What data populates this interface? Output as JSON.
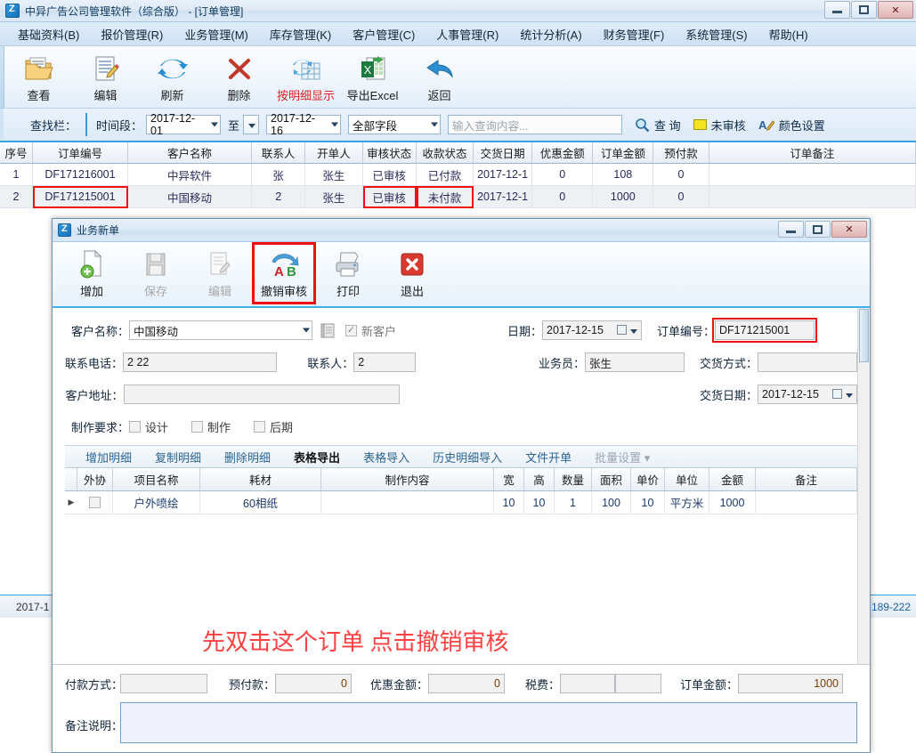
{
  "main_window": {
    "title": "中异广告公司管理软件（综合版） - [订单管理]",
    "window_buttons": {
      "minimize": "minimize-icon",
      "maximize": "maximize-icon",
      "close": "✕"
    },
    "menu": [
      {
        "label": "基础资料(B)"
      },
      {
        "label": "报价管理(R)"
      },
      {
        "label": "业务管理(M)"
      },
      {
        "label": "库存管理(K)"
      },
      {
        "label": "客户管理(C)"
      },
      {
        "label": "人事管理(R)"
      },
      {
        "label": "统计分析(A)"
      },
      {
        "label": "财务管理(F)"
      },
      {
        "label": "系统管理(S)"
      },
      {
        "label": "帮助(H)"
      }
    ],
    "toolbar": [
      {
        "label": "查看",
        "icon": "folder-view-icon",
        "highlight": false
      },
      {
        "label": "编辑",
        "icon": "edit-doc-icon",
        "highlight": false
      },
      {
        "label": "刷新",
        "icon": "refresh-icon",
        "highlight": false
      },
      {
        "label": "删除",
        "icon": "delete-x-icon",
        "highlight": false
      },
      {
        "label": "按明细显示",
        "icon": "detail-grid-icon",
        "highlight": true
      },
      {
        "label": "导出Excel",
        "icon": "export-excel-icon",
        "highlight": false
      },
      {
        "label": "返回",
        "icon": "back-arrow-icon",
        "highlight": false
      }
    ],
    "searchbar": {
      "label": "查找栏：",
      "period_label": "时间段：",
      "date_from": "2017-12-01",
      "to_label": "至",
      "date_to": "2017-12-16",
      "field_select": "全部字段",
      "query_placeholder": "输入查询内容...",
      "query_value": "",
      "search_button": "查 询",
      "unaudited_label": "未审核",
      "color_setting_label": "颜色设置"
    },
    "grid": {
      "columns": [
        "序号",
        "订单编号",
        "客户名称",
        "联系人",
        "开单人",
        "审核状态",
        "收款状态",
        "交货日期",
        "优惠金额",
        "订单金额",
        "预付款",
        "订单备注"
      ],
      "rows": [
        {
          "seq": "1",
          "order_no": "DF171216001",
          "customer": "中异软件",
          "contact": "张",
          "operator": "张生",
          "audit": "已审核",
          "payment": "已付款",
          "delivery": "2017-12-1",
          "discount": "0",
          "amount": "108",
          "prepaid": "0",
          "memo": ""
        },
        {
          "seq": "2",
          "order_no": "DF171215001",
          "customer": "中国移动",
          "contact": "2",
          "operator": "张生",
          "audit": "已审核",
          "payment": "未付款",
          "delivery": "2017-12-1",
          "discount": "0",
          "amount": "1000",
          "prepaid": "0",
          "memo": ""
        }
      ]
    },
    "statusbar": {
      "left": "2017-1",
      "right": ": 189-222"
    }
  },
  "dialog": {
    "title": "业务新单",
    "window_buttons": {
      "minimize": "minimize-icon",
      "maximize": "maximize-icon",
      "close": "✕"
    },
    "toolbar": [
      {
        "label": "增加",
        "icon": "add-doc-icon",
        "disabled": false,
        "highlight": false
      },
      {
        "label": "保存",
        "icon": "save-disk-icon",
        "disabled": true,
        "highlight": false
      },
      {
        "label": "编辑",
        "icon": "edit-doc-icon",
        "disabled": true,
        "highlight": false
      },
      {
        "label": "撤销审核",
        "icon": "undo-audit-icon",
        "disabled": false,
        "highlight": true
      },
      {
        "label": "打印",
        "icon": "printer-icon",
        "disabled": false,
        "highlight": false
      },
      {
        "label": "退出",
        "icon": "exit-x-icon",
        "disabled": false,
        "highlight": false
      }
    ],
    "form": {
      "customer_name_label": "客户名称：",
      "customer_name": "中国移动",
      "address_book_icon": "address-book-icon",
      "new_customer_label": "新客户",
      "new_customer_checked": true,
      "phone_label": "联系电话：",
      "phone": "2 22",
      "contact_label": "联系人：",
      "contact": "2",
      "address_label": "客户地址：",
      "address": "",
      "requirement_label": "制作要求：",
      "requirements": [
        {
          "label": "设计",
          "checked": false
        },
        {
          "label": "制作",
          "checked": false
        },
        {
          "label": "后期",
          "checked": false
        }
      ],
      "date_label": "日期：",
      "date": "2017-12-15",
      "order_no_label": "订单编号：",
      "order_no": "DF171215001",
      "salesman_label": "业务员：",
      "salesman": "张生",
      "delivery_method_label": "交货方式：",
      "delivery_method": "",
      "delivery_date_label": "交货日期：",
      "delivery_date": "2017-12-15"
    },
    "tabs": [
      {
        "label": "增加明细",
        "state": "normal"
      },
      {
        "label": "复制明细",
        "state": "normal"
      },
      {
        "label": "删除明细",
        "state": "normal"
      },
      {
        "label": "表格导出",
        "state": "active"
      },
      {
        "label": "表格导入",
        "state": "normal"
      },
      {
        "label": "历史明细导入",
        "state": "normal"
      },
      {
        "label": "文件开单",
        "state": "normal"
      },
      {
        "label": "批量设置 ▾",
        "state": "muted"
      }
    ],
    "detail_grid": {
      "columns": [
        "外协",
        "项目名称",
        "耗材",
        "制作内容",
        "宽",
        "高",
        "数量",
        "面积",
        "单价",
        "单位",
        "金额",
        "备注"
      ],
      "rows": [
        {
          "outsource": false,
          "item": "户外喷绘",
          "material": "60相纸",
          "content": "",
          "width": "10",
          "height": "10",
          "qty": "1",
          "area": "100",
          "price": "10",
          "unit": "平方米",
          "amount": "1000",
          "memo": ""
        }
      ]
    },
    "annotation": "先双击这个订单 点击撤销审核",
    "footer": {
      "payment_method_label": "付款方式：",
      "payment_method": "",
      "prepaid_label": "预付款：",
      "prepaid": "0",
      "discount_label": "优惠金额：",
      "discount": "0",
      "tax_label": "税费：",
      "tax": "",
      "tax2": "",
      "order_amount_label": "订单金额：",
      "order_amount": "1000",
      "memo_label": "备注说明：",
      "memo": ""
    }
  },
  "colors": {
    "accent_blue": "#2f9fe3",
    "highlight_red": "#f01010",
    "annotation_red": "#ff4040",
    "toolbar_red_text": "#e02020"
  }
}
